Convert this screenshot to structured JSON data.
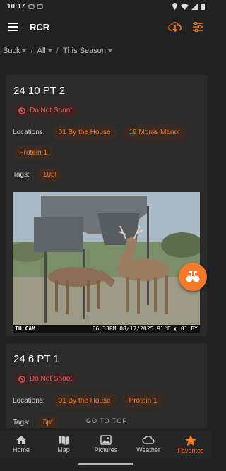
{
  "status": {
    "time": "10:17"
  },
  "appbar": {
    "title": "RCR"
  },
  "filters": [
    {
      "label": "Buck"
    },
    {
      "label": "All"
    },
    {
      "label": "This Season"
    }
  ],
  "cards": [
    {
      "title": "24 10 PT 2",
      "badge": "Do Not Shoot",
      "locations_label": "Locations:",
      "locations": [
        "01 By the House",
        "19 Morris Manor",
        "Protein 1"
      ],
      "tags_label": "Tags:",
      "tags": [
        "10pt"
      ],
      "photo": {
        "camera": "TH CAM",
        "stamp": "06:33PM 08/17/2025  91°F  ◐ 01 BY"
      }
    },
    {
      "title": "24 6 PT 1",
      "badge": "Do Not Shoot",
      "locations_label": "Locations:",
      "locations": [
        "01 By the House",
        "Protein 1"
      ],
      "tags_label": "Tags:",
      "tags": [
        "6pt"
      ]
    }
  ],
  "go_to_top": "GO TO TOP",
  "nav": [
    {
      "label": "Home",
      "icon": "home-icon"
    },
    {
      "label": "Map",
      "icon": "map-icon"
    },
    {
      "label": "Pictures",
      "icon": "pictures-icon"
    },
    {
      "label": "Weather",
      "icon": "cloud-icon"
    },
    {
      "label": "Favorites",
      "icon": "star-icon",
      "active": true
    }
  ],
  "colors": {
    "accent": "#f47a2a",
    "danger": "#ef5a5a",
    "background": "#212121",
    "card": "#2b2b2b"
  }
}
